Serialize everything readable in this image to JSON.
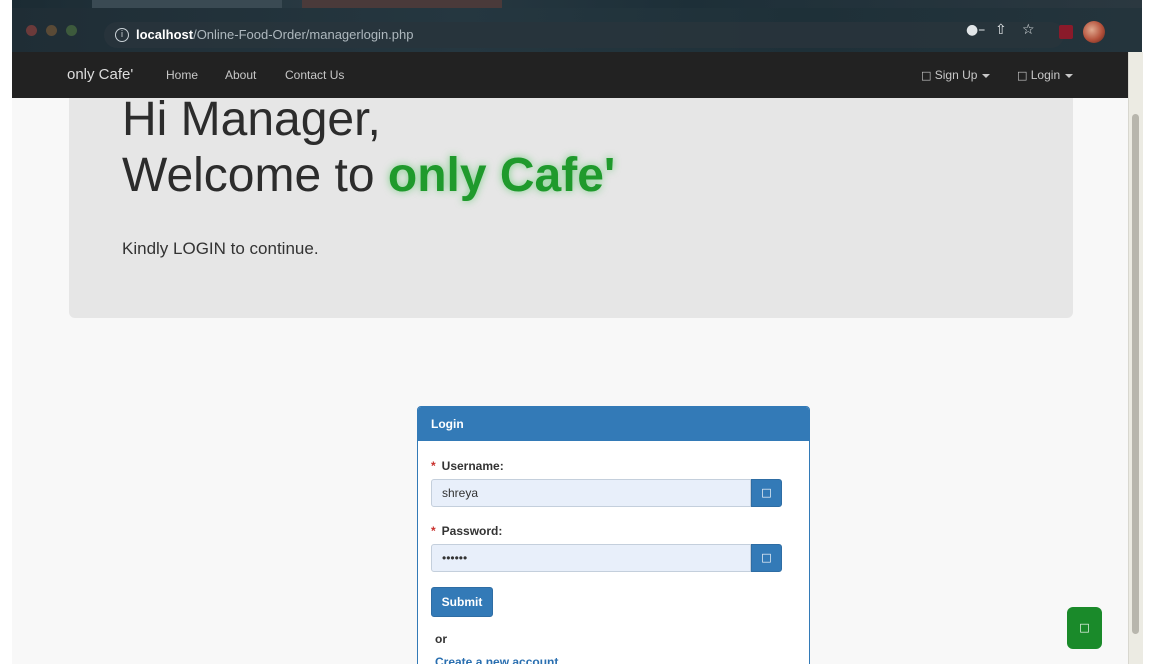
{
  "browser": {
    "url_host": "localhost",
    "url_path": "/Online-Food-Order/managerlogin.php",
    "icons": [
      "info-icon",
      "key-icon",
      "share-icon",
      "star-icon",
      "extension-icon",
      "profile-avatar"
    ]
  },
  "navbar": {
    "brand": "only Cafe'",
    "links": [
      "Home",
      "About",
      "Contact Us"
    ],
    "signup": "Sign Up",
    "login": "Login",
    "icon_glyph": "□"
  },
  "hero": {
    "line1": "Hi Manager,",
    "line2_prefix": "Welcome to ",
    "line2_brand": "only Cafe'",
    "subtitle": "Kindly LOGIN to continue."
  },
  "login_panel": {
    "title": "Login",
    "username_label": "Username:",
    "username_value": "shreya",
    "password_label": "Password:",
    "password_value": "shreya",
    "required_mark": "*",
    "addon_glyph": "□",
    "submit_label": "Submit",
    "or_text": "or",
    "create_account": "Create a new account."
  },
  "floating_button": {
    "glyph": "□"
  },
  "colors": {
    "navbar_bg": "#222222",
    "primary": "#337ab7",
    "brand_green": "#1f9a2c",
    "jumbotron_bg": "#e6e6e6",
    "float_green": "#1a8a2a"
  }
}
